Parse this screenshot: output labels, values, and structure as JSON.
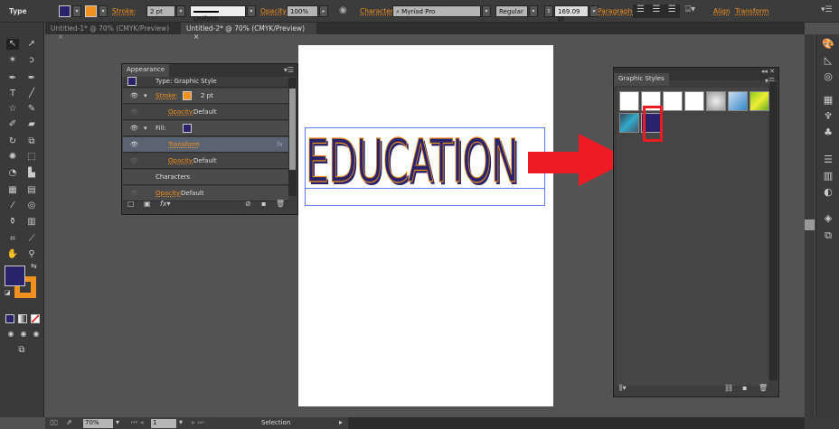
{
  "control_bar": {
    "tool_name": "Type",
    "stroke_label": "Stroke:",
    "stroke_value": "2 pt",
    "stroke_profile": "Uniform",
    "opacity_label": "Opacity:",
    "opacity_value": "100%",
    "character_label": "Character:",
    "font_family": "Myriad Pro",
    "font_style": "Regular",
    "font_size": "169.09 pt",
    "paragraph_label": "Paragraph:",
    "align_label": "Align",
    "transform_label": "Transform"
  },
  "tabs": [
    {
      "label": "Untitled-1* @ 70% (CMYK/Preview)"
    },
    {
      "label": "Untitled-2* @ 70% (CMYK/Preview)"
    }
  ],
  "canvas": {
    "text": "EDUCATION"
  },
  "appearance": {
    "title": "Appearance",
    "header": "Type: Graphic Style",
    "rows": [
      {
        "label": "Stroke:",
        "value": "2 pt"
      },
      {
        "label": "Opacity:",
        "value": "Default"
      },
      {
        "label": "Fill:",
        "value": ""
      },
      {
        "label": "Transform",
        "value": "fx"
      },
      {
        "label": "Opacity:",
        "value": "Default"
      },
      {
        "label": "Characters",
        "value": ""
      },
      {
        "label": "Opacity:",
        "value": "Default"
      }
    ]
  },
  "graphic_styles": {
    "title": "Graphic Styles"
  },
  "status": {
    "zoom": "70%",
    "page": "1",
    "tool": "Selection"
  },
  "colors": {
    "fill": "#28236a",
    "stroke": "#f0901e",
    "arrow": "#ed1c24",
    "selection": "#5b7ff0"
  }
}
